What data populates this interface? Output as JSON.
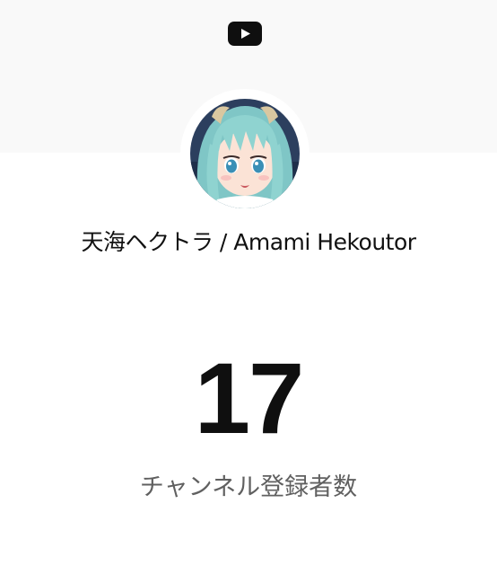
{
  "header": {
    "logo_icon": "youtube-play-icon"
  },
  "channel": {
    "avatar_icon": "channel-avatar",
    "name": "天海ヘクトラ / Amami Hekoutor"
  },
  "subscribers": {
    "count": "17",
    "label": "チャンネル登録者数"
  },
  "colors": {
    "top_band": "#f9f9f9",
    "background": "#ffffff",
    "count_text": "#0f0f0f",
    "label_text": "#606060"
  }
}
